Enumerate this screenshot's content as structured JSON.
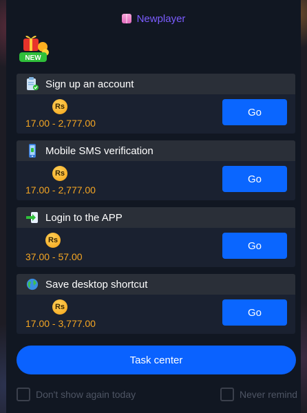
{
  "header": {
    "player_name": "Newplayer",
    "new_badge_text": "NEW"
  },
  "tasks": [
    {
      "title": "Sign up an account",
      "currency": "Rs",
      "range": "17.00 - 2,777.00",
      "button": "Go",
      "icon": "clipboard-check-icon"
    },
    {
      "title": "Mobile SMS verification",
      "currency": "Rs",
      "range": "17.00 - 2,777.00",
      "button": "Go",
      "icon": "mobile-phone-icon"
    },
    {
      "title": "Login to the APP",
      "currency": "Rs",
      "range": "37.00 - 57.00",
      "button": "Go",
      "icon": "login-arrow-icon"
    },
    {
      "title": "Save desktop shortcut",
      "currency": "Rs",
      "range": "17.00 - 3,777.00",
      "button": "Go",
      "icon": "globe-icon"
    }
  ],
  "footer": {
    "task_center_label": "Task center",
    "dont_show_label": "Don't show again today",
    "never_remind_label": "Never remind"
  },
  "colors": {
    "accent": "#0a66ff",
    "reward": "#f5a623",
    "player_name": "#7b5cff"
  }
}
